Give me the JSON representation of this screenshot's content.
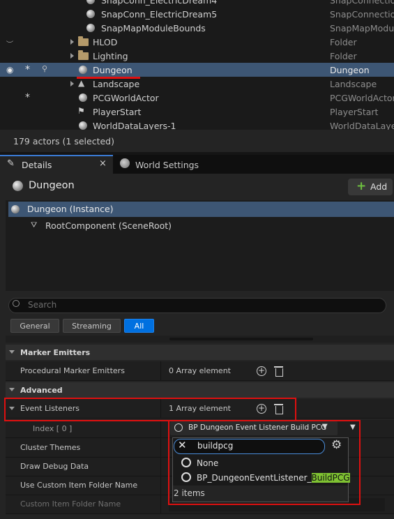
{
  "outliner": {
    "rows": [
      {
        "name": "SnapConn_ElectricDream4",
        "type": "SnapConnection"
      },
      {
        "name": "SnapConn_ElectricDream5",
        "type": "SnapConnection"
      },
      {
        "name": "SnapMapModuleBounds",
        "type": "SnapMapModule"
      },
      {
        "name": "HLOD",
        "type": "Folder"
      },
      {
        "name": "Lighting",
        "type": "Folder"
      },
      {
        "name": "Dungeon",
        "type": "Dungeon"
      },
      {
        "name": "Landscape",
        "type": "Landscape"
      },
      {
        "name": "PCGWorldActor",
        "type": "PCGWorldActor"
      },
      {
        "name": "PlayerStart",
        "type": "PlayerStart"
      },
      {
        "name": "WorldDataLayers-1",
        "type": "WorldDataLayer"
      }
    ],
    "status": "179 actors (1 selected)"
  },
  "tabs": {
    "details": "Details",
    "close": "×",
    "world_settings": "World Settings"
  },
  "details": {
    "actor_name": "Dungeon",
    "add_label": "Add",
    "components": [
      {
        "name": "Dungeon (Instance)"
      },
      {
        "name": "RootComponent (SceneRoot)"
      }
    ],
    "search_placeholder": "Search",
    "filters": [
      "General",
      "Streaming",
      "All"
    ],
    "active_filter": "All"
  },
  "properties": {
    "cat_marker": "Marker Emitters",
    "procedural_marker_emitters": {
      "label": "Procedural Marker Emitters",
      "value": "0 Array element"
    },
    "cat_advanced": "Advanced",
    "event_listeners": {
      "label": "Event Listeners",
      "value": "1 Array element"
    },
    "index0": {
      "label": "Index [ 0 ]",
      "value": "BP Dungeon Event Listener Build PCG"
    },
    "cluster_themes": "Cluster Themes",
    "draw_debug_data": "Draw Debug Data",
    "use_custom_item_folder_name": "Use Custom Item Folder Name",
    "custom_item_folder_name": "Custom Item Folder Name"
  },
  "picker": {
    "search_value": "buildpcg",
    "options": [
      {
        "prefix": "None",
        "highlight": ""
      },
      {
        "prefix": "BP_DungeonEventListener_",
        "highlight": "BuildPCG"
      }
    ],
    "count": "2 items"
  },
  "colors": {
    "accent": "#0070e0",
    "selection": "#3d5674",
    "annotation": "#e01010",
    "highlight": "#7fc232"
  }
}
